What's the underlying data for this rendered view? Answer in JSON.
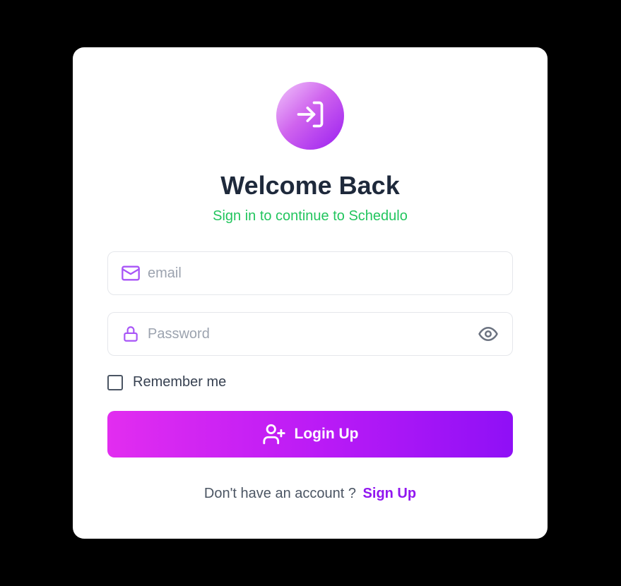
{
  "header": {
    "logo_icon": "login-arrow-icon",
    "title": "Welcome Back",
    "subtitle": "Sign in to continue to Schedulo"
  },
  "form": {
    "email": {
      "icon": "mail-icon",
      "placeholder": "email",
      "value": ""
    },
    "password": {
      "icon": "lock-icon",
      "placeholder": "Password",
      "value": "",
      "toggle_icon": "eye-icon"
    },
    "remember": {
      "label": "Remember me",
      "checked": false
    },
    "submit": {
      "label": "Login Up",
      "icon": "user-plus-icon"
    }
  },
  "footer": {
    "prompt": "Don't have an account ?",
    "link_label": "Sign Up"
  },
  "colors": {
    "background": "#000000",
    "card": "#ffffff",
    "title": "#1e293b",
    "subtitle": "#22c55e",
    "accent_icon": "#a855f7",
    "button_start": "#e22df0",
    "button_end": "#8f10f6",
    "link": "#9116f0"
  }
}
